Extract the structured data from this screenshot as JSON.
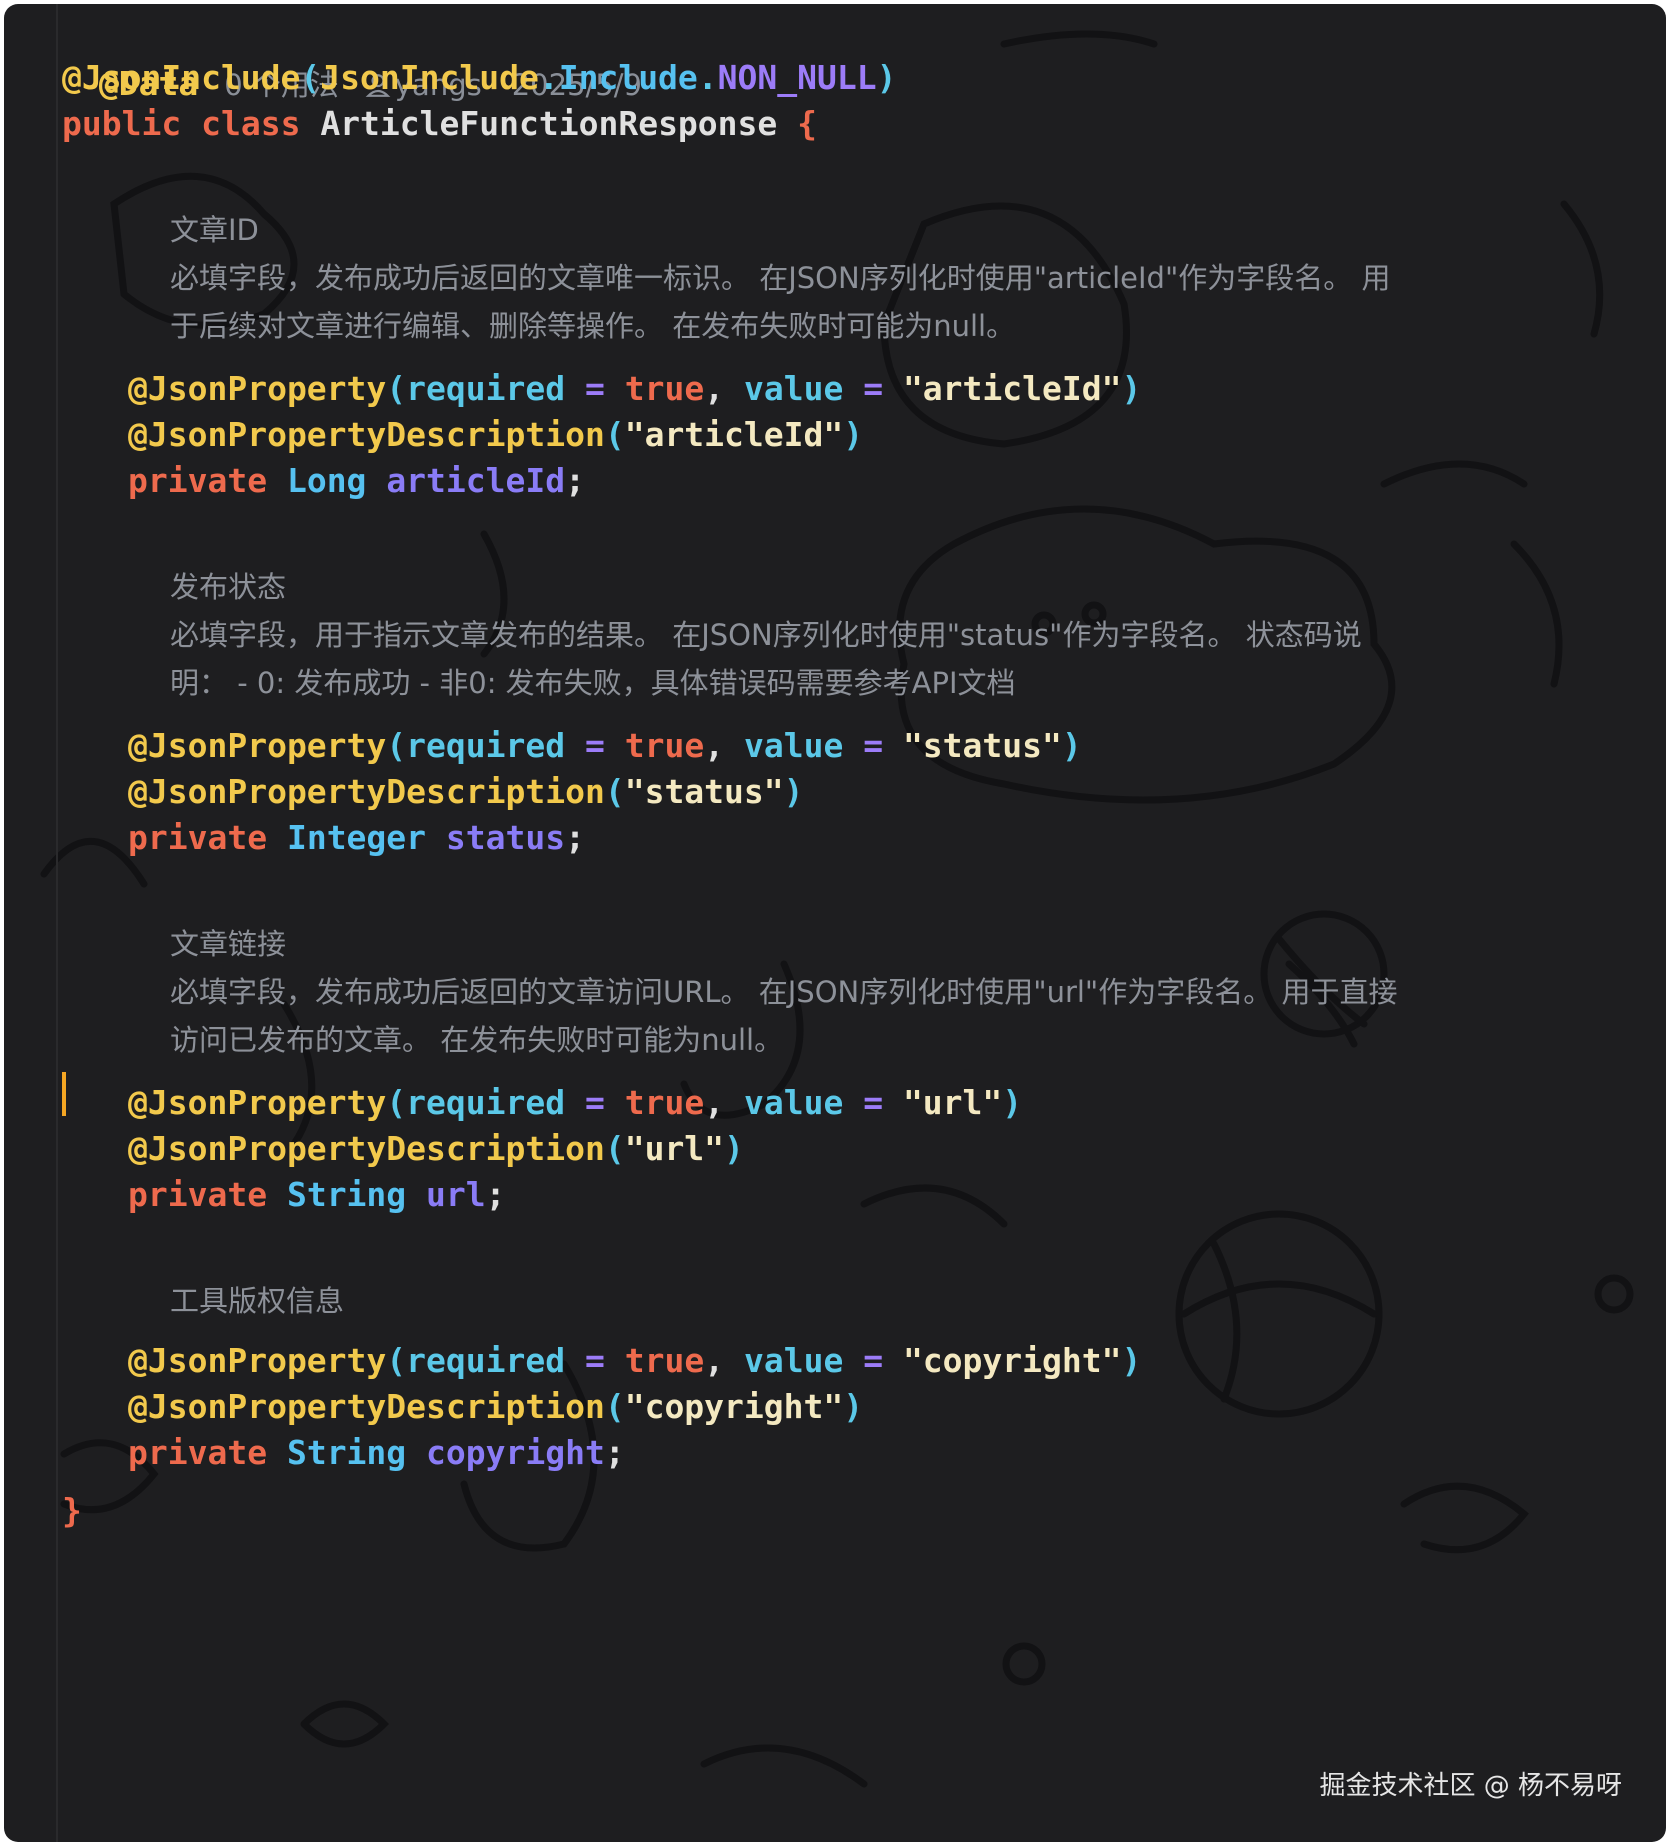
{
  "header": {
    "annotation": "@Data",
    "usages": "0 个用法",
    "author": "yangs",
    "date": "2025/5/9"
  },
  "class_decl": {
    "annotation": "@JsonInclude",
    "paren_open": "(",
    "arg_class": "JsonInclude",
    "dot1": ".",
    "arg_inner": "Include",
    "dot2": ".",
    "arg_value": "NON_NULL",
    "paren_close": ")",
    "kw_public": "public",
    "kw_class": "class",
    "class_name": "ArticleFunctionResponse",
    "brace_open": "{",
    "brace_close": "}"
  },
  "syntax": {
    "json_property": "@JsonProperty",
    "json_property_desc": "@JsonPropertyDescription",
    "open": "(",
    "close": ")",
    "required": "required",
    "eq": "=",
    "true": "true",
    "comma": ",",
    "value": "value",
    "private": "private",
    "semi": ";"
  },
  "fields": [
    {
      "doc_title": "文章ID",
      "doc_body": "必填字段，发布成功后返回的文章唯一标识。 在JSON序列化时使用\"articleId\"作为字段名。 用于后续对文章进行编辑、删除等操作。 在发布失败时可能为null。",
      "property_value": "\"articleId\"",
      "description_value": "\"articleId\"",
      "type": "Long",
      "name": "articleId"
    },
    {
      "doc_title": "发布状态",
      "doc_body": "必填字段，用于指示文章发布的结果。 在JSON序列化时使用\"status\"作为字段名。 状态码说明： - 0: 发布成功 - 非0: 发布失败，具体错误码需要参考API文档",
      "property_value": "\"status\"",
      "description_value": "\"status\"",
      "type": "Integer",
      "name": "status"
    },
    {
      "doc_title": "文章链接",
      "doc_body": "必填字段，发布成功后返回的文章访问URL。 在JSON序列化时使用\"url\"作为字段名。 用于直接访问已发布的文章。 在发布失败时可能为null。",
      "property_value": "\"url\"",
      "description_value": "\"url\"",
      "type": "String",
      "name": "url"
    },
    {
      "doc_title": "工具版权信息",
      "doc_body": "",
      "property_value": "\"copyright\"",
      "description_value": "\"copyright\"",
      "type": "String",
      "name": "copyright"
    }
  ],
  "watermark": "掘金技术社区 @ 杨不易呀",
  "colors": {
    "background": "#1e1e20",
    "annotation": "#f2c94c",
    "keyword": "#ee6a4d",
    "type": "#56c1f0",
    "field_name": "#8a7cf6",
    "string": "#f4e9c1",
    "comment": "#8d9199",
    "caret": "#f5a623"
  },
  "icons": [
    "user-icon"
  ]
}
